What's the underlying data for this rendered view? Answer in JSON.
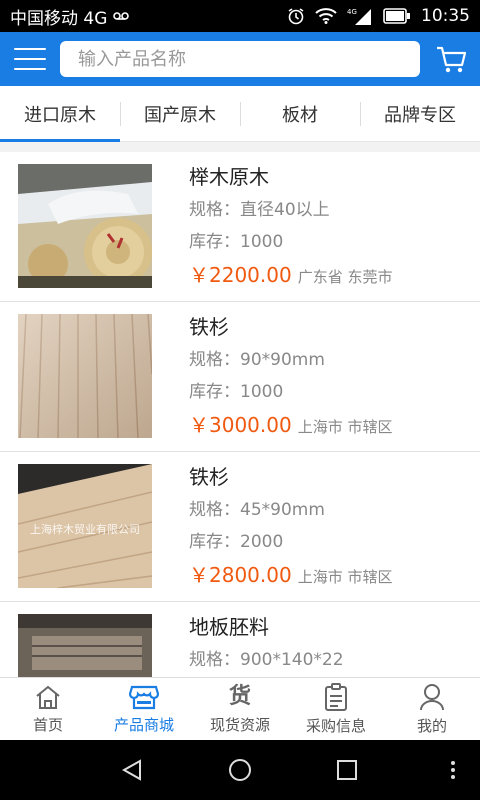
{
  "status_bar": {
    "carrier": "中国移动 4G",
    "network_4g": "4G",
    "time": "10:35"
  },
  "header": {
    "search_placeholder": "输入产品名称"
  },
  "tabs": [
    {
      "label": "进口原木",
      "active": true
    },
    {
      "label": "国产原木",
      "active": false
    },
    {
      "label": "板材",
      "active": false
    },
    {
      "label": "品牌专区",
      "active": false
    }
  ],
  "products": [
    {
      "name": "榉木原木",
      "spec": "规格：直径40以上",
      "stock": "库存：1000",
      "price": "￥2200.00",
      "location": "广东省 东莞市",
      "image": "log-pile"
    },
    {
      "name": "铁杉",
      "spec": "规格：90*90mm",
      "stock": "库存：1000",
      "price": "￥3000.00",
      "location": "上海市 市辖区",
      "image": "pale-lumber-planks"
    },
    {
      "name": "铁杉",
      "spec": "规格：45*90mm",
      "stock": "库存：2000",
      "price": "￥2800.00",
      "location": "上海市 市辖区",
      "image": "pale-lumber-planks-watermarked",
      "watermark": "上海梓木贸业有限公司"
    },
    {
      "name": "地板胚料",
      "spec": "规格：900*140*22",
      "stock": "",
      "price": "",
      "location": "",
      "image": "floor-blanks"
    }
  ],
  "bottom_nav": [
    {
      "label": "首页",
      "icon": "home-icon",
      "active": false
    },
    {
      "label": "产品商城",
      "icon": "store-icon",
      "active": true
    },
    {
      "label": "现货资源",
      "icon": "goods-icon",
      "glyph": "货",
      "active": false
    },
    {
      "label": "采购信息",
      "icon": "clipboard-icon",
      "active": false
    },
    {
      "label": "我的",
      "icon": "person-icon",
      "active": false
    }
  ],
  "colors": {
    "accent": "#1a7de4",
    "price": "#f05a10"
  }
}
